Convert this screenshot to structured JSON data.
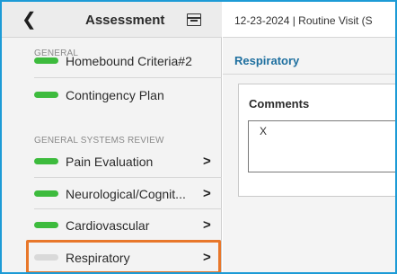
{
  "sidebar": {
    "header": {
      "back_icon": "chevron-left-icon",
      "title": "Assessment",
      "calendar_icon": "calendar-icon"
    },
    "sections": [
      {
        "label": "GENERAL",
        "items": [
          {
            "label": "Homebound Criteria#2",
            "status": "complete"
          },
          {
            "label": "Contingency Plan",
            "status": "complete"
          }
        ]
      },
      {
        "label": "GENERAL SYSTEMS REVIEW",
        "items": [
          {
            "label": "Pain Evaluation",
            "status": "complete"
          },
          {
            "label": "Neurological/Cognit...",
            "status": "complete"
          },
          {
            "label": "Cardiovascular",
            "status": "complete"
          },
          {
            "label": "Respiratory",
            "status": "incomplete",
            "selected": true
          }
        ]
      }
    ],
    "chevron_icon": "chevron-right-icon"
  },
  "main": {
    "visit_header": "12-23-2024 | Routine Visit (S",
    "section_title": "Respiratory",
    "comments": {
      "title": "Comments",
      "value": "X"
    }
  },
  "colors": {
    "status_complete": "#3dbb3d",
    "status_incomplete": "#d9d9d9",
    "highlight": "#e8772a",
    "section_title": "#1e6f9f",
    "frame_border": "#1d9bd6"
  }
}
